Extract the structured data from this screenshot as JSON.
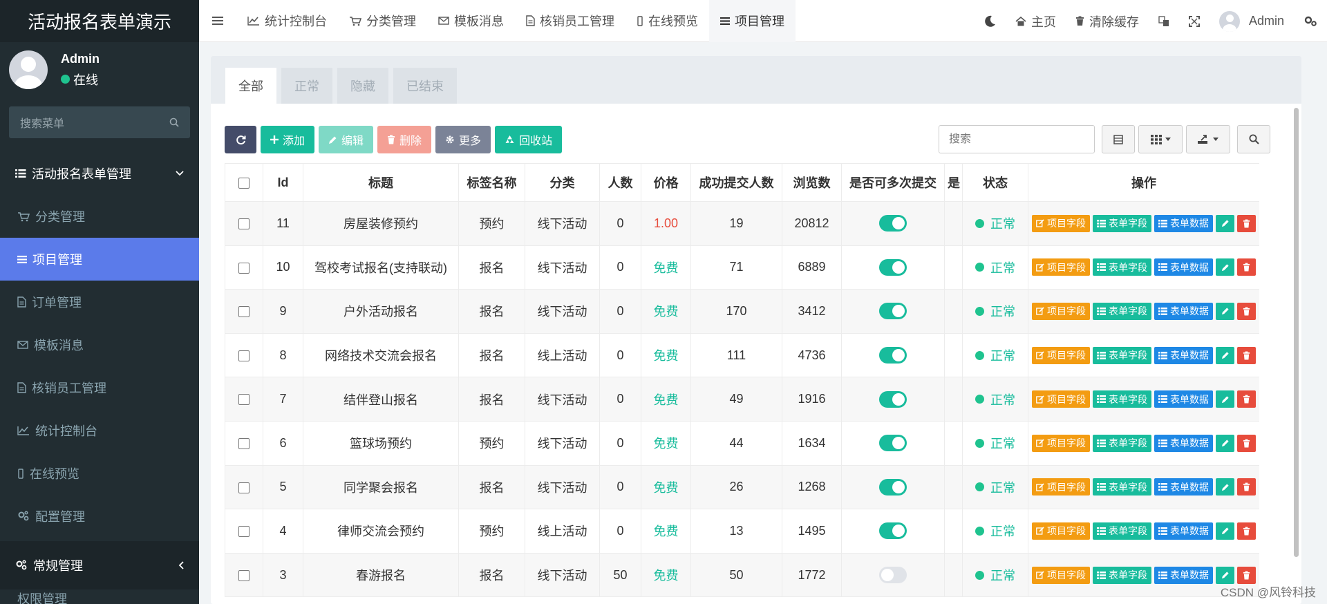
{
  "app": {
    "brand": "活动报名表单演示"
  },
  "user": {
    "name": "Admin",
    "status": "在线"
  },
  "sidebar": {
    "search_placeholder": "搜索菜单",
    "group1": "活动报名表单管理",
    "items": [
      {
        "label": "分类管理",
        "icon": "cart-icon"
      },
      {
        "label": "项目管理",
        "icon": "list-icon",
        "active": true
      },
      {
        "label": "订单管理",
        "icon": "file-icon"
      },
      {
        "label": "模板消息",
        "icon": "envelope-icon"
      },
      {
        "label": "核销员工管理",
        "icon": "file-icon"
      },
      {
        "label": "统计控制台",
        "icon": "line-chart-icon"
      },
      {
        "label": "在线预览",
        "icon": "mobile-icon"
      },
      {
        "label": "配置管理",
        "icon": "cogs-icon"
      }
    ],
    "group2": "常规管理",
    "cut_item": "权限管理"
  },
  "topnav": {
    "items": [
      {
        "label": "统计控制台"
      },
      {
        "label": "分类管理"
      },
      {
        "label": "模板消息"
      },
      {
        "label": "核销员工管理"
      },
      {
        "label": "在线预览"
      },
      {
        "label": "项目管理"
      }
    ],
    "home": "主页",
    "clear_cache": "清除缓存",
    "admin": "Admin"
  },
  "tabs": [
    "全部",
    "正常",
    "隐藏",
    "已结束"
  ],
  "toolbar": {
    "add": "添加",
    "edit": "编辑",
    "delete": "删除",
    "more": "更多",
    "recycle": "回收站",
    "search_placeholder": "搜索"
  },
  "table": {
    "headers": [
      "Id",
      "标题",
      "标签名称",
      "分类",
      "人数",
      "价格",
      "成功提交人数",
      "浏览数",
      "是否可多次提交",
      "是",
      "状态",
      "操作"
    ],
    "ops": {
      "fields": "项目字段",
      "form_fields": "表单字段",
      "form_data": "表单数据"
    },
    "rows": [
      {
        "id": "11",
        "title": "房屋装修预约",
        "tag": "预约",
        "category": "线下活动",
        "people": "0",
        "price": "1.00",
        "price_type": "red",
        "success": "19",
        "views": "20812",
        "multi": true,
        "status": "正常"
      },
      {
        "id": "10",
        "title": "驾校考试报名(支持联动)",
        "tag": "报名",
        "category": "线下活动",
        "people": "0",
        "price": "免费",
        "price_type": "green",
        "success": "71",
        "views": "6889",
        "multi": true,
        "status": "正常"
      },
      {
        "id": "9",
        "title": "户外活动报名",
        "tag": "报名",
        "category": "线下活动",
        "people": "0",
        "price": "免费",
        "price_type": "green",
        "success": "170",
        "views": "3412",
        "multi": true,
        "status": "正常"
      },
      {
        "id": "8",
        "title": "网络技术交流会报名",
        "tag": "报名",
        "category": "线上活动",
        "people": "0",
        "price": "免费",
        "price_type": "green",
        "success": "111",
        "views": "4736",
        "multi": true,
        "status": "正常"
      },
      {
        "id": "7",
        "title": "结伴登山报名",
        "tag": "报名",
        "category": "线下活动",
        "people": "0",
        "price": "免费",
        "price_type": "green",
        "success": "49",
        "views": "1916",
        "multi": true,
        "status": "正常"
      },
      {
        "id": "6",
        "title": "篮球场预约",
        "tag": "预约",
        "category": "线下活动",
        "people": "0",
        "price": "免费",
        "price_type": "green",
        "success": "44",
        "views": "1634",
        "multi": true,
        "status": "正常"
      },
      {
        "id": "5",
        "title": "同学聚会报名",
        "tag": "报名",
        "category": "线下活动",
        "people": "0",
        "price": "免费",
        "price_type": "green",
        "success": "26",
        "views": "1268",
        "multi": true,
        "status": "正常"
      },
      {
        "id": "4",
        "title": "律师交流会预约",
        "tag": "预约",
        "category": "线上活动",
        "people": "0",
        "price": "免费",
        "price_type": "green",
        "success": "13",
        "views": "1495",
        "multi": true,
        "status": "正常"
      },
      {
        "id": "3",
        "title": "春游报名",
        "tag": "报名",
        "category": "线下活动",
        "people": "50",
        "price": "免费",
        "price_type": "green",
        "success": "50",
        "views": "1772",
        "multi": false,
        "status": "正常"
      }
    ]
  },
  "watermark": "CSDN @风铃科技",
  "colors": {
    "sidebar_bg": "#222d32",
    "active_menu": "#5b7bea",
    "accent_green": "#18bc9c",
    "price_red": "#e74c3c"
  }
}
